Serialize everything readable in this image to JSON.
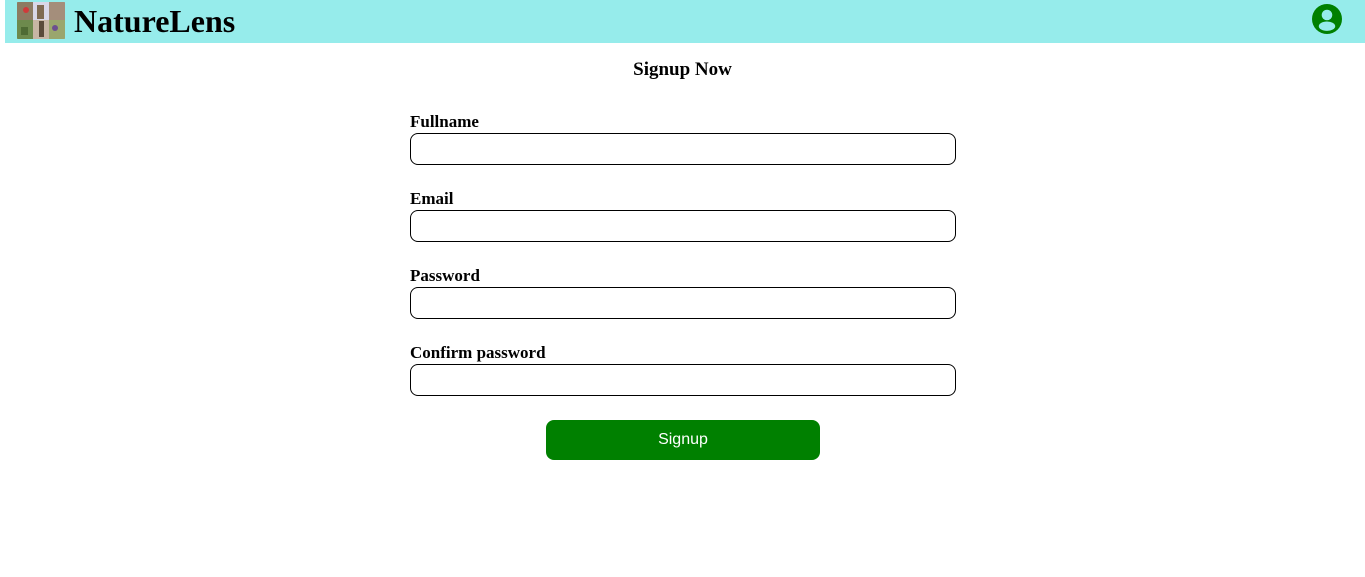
{
  "header": {
    "brand": "NatureLens",
    "logo_icon": "nature-collage-logo",
    "profile_icon": "user-circle-icon",
    "background_color": "#96eceb",
    "accent_color": "#008000"
  },
  "form": {
    "title": "Signup Now",
    "fields": [
      {
        "label": "Fullname",
        "value": "",
        "placeholder": ""
      },
      {
        "label": "Email",
        "value": "",
        "placeholder": ""
      },
      {
        "label": "Password",
        "value": "",
        "placeholder": ""
      },
      {
        "label": "Confirm password",
        "value": "",
        "placeholder": ""
      }
    ],
    "submit_label": "Signup"
  }
}
